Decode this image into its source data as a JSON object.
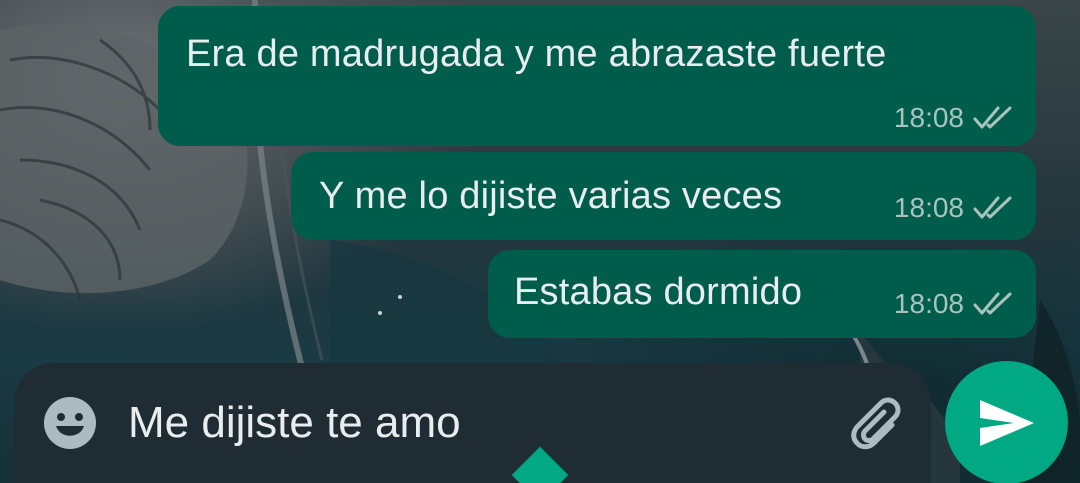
{
  "messages": [
    {
      "text": "Era de madrugada y me abrazaste fuerte",
      "time": "18:08",
      "status": "read"
    },
    {
      "text": "Y me lo dijiste varias veces",
      "time": "18:08",
      "status": "read"
    },
    {
      "text": "Estabas dormido",
      "time": "18:08",
      "status": "read"
    }
  ],
  "composer": {
    "text": "Me dijiste te amo",
    "emoji_icon": "emoji-icon",
    "attach_icon": "paperclip-icon",
    "send_icon": "send-icon"
  },
  "colors": {
    "outgoing_bubble": "#005c4b",
    "input_bar": "#1f2c33",
    "accent": "#00a884",
    "text": "#e9edef",
    "meta_text": "#a9c3bd"
  }
}
